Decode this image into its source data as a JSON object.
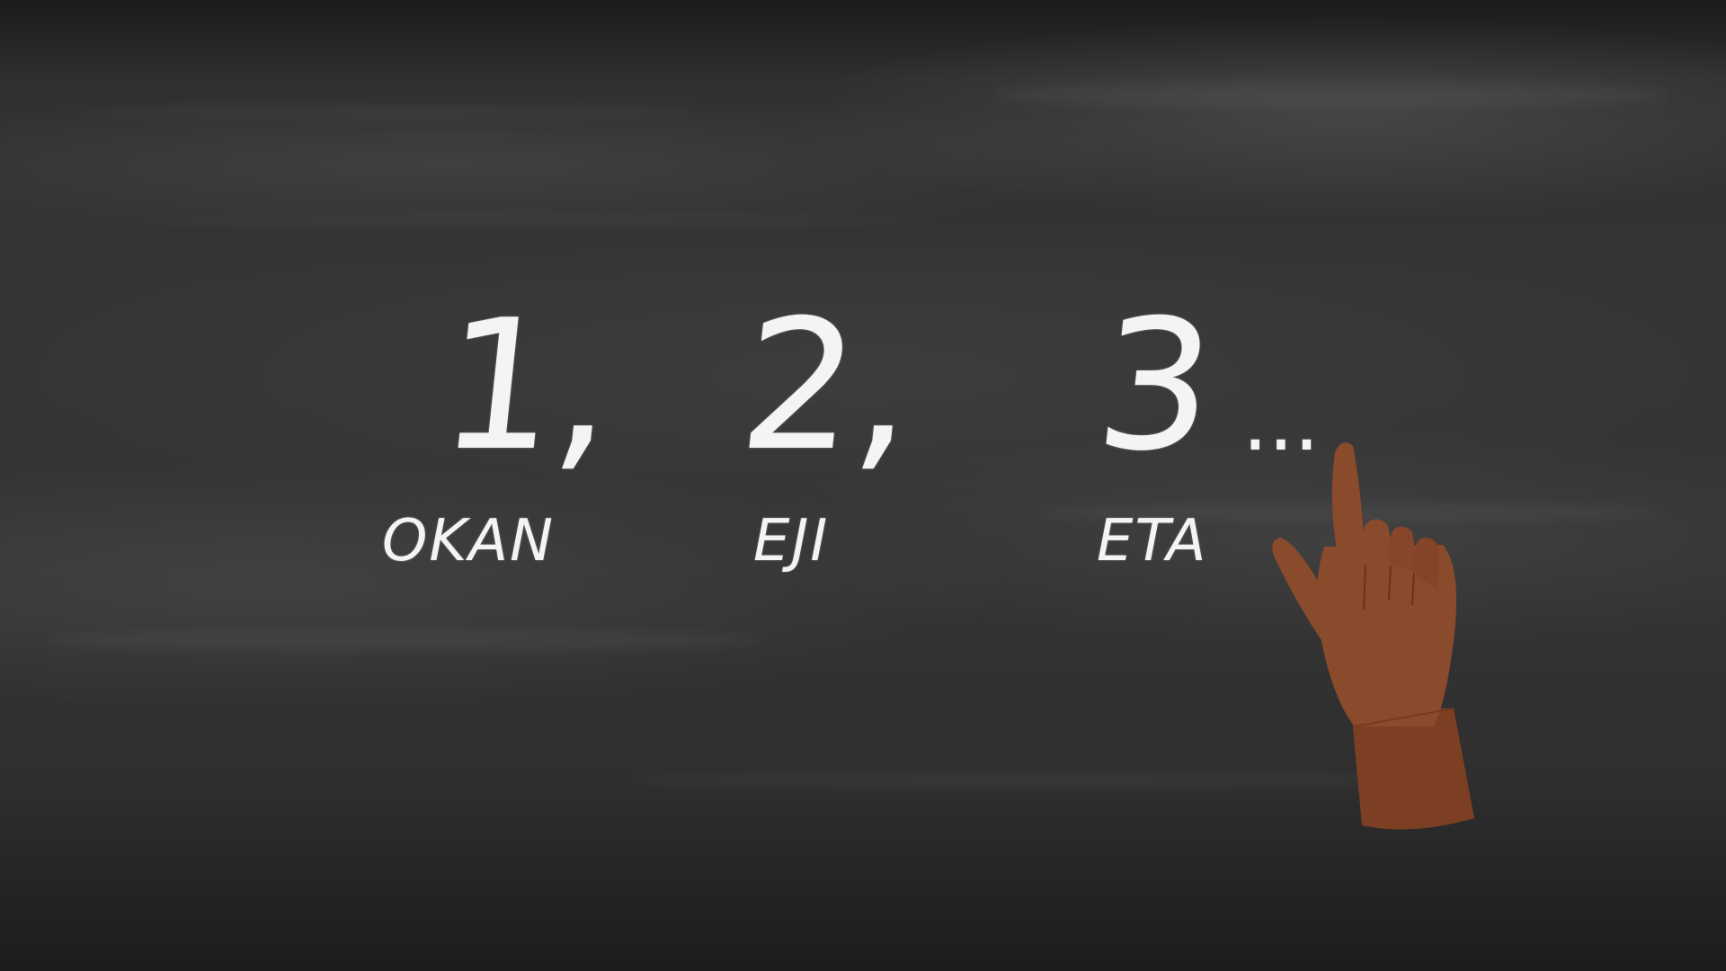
{
  "board": {
    "numbers": [
      {
        "numeral": "1,",
        "word": "OKAN"
      },
      {
        "numeral": "2,",
        "word": "EJI"
      },
      {
        "numeral": "3",
        "word": "ETA"
      }
    ],
    "ellipsis": "...",
    "hand_icon": "pointing-hand-icon",
    "colors": {
      "board": "#333333",
      "chalk": "#f4f4f2",
      "hand": "#8a4a2c"
    }
  }
}
